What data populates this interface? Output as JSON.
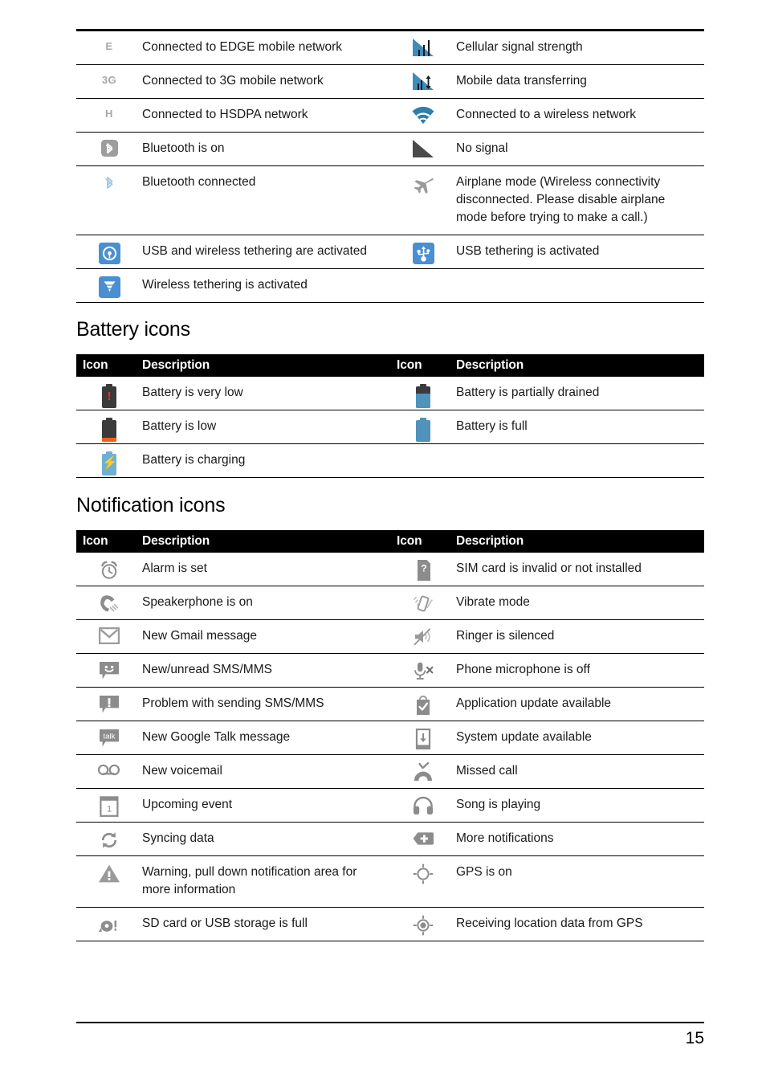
{
  "document": {
    "page_number": "15",
    "sections": [
      {
        "id": "status-icons-continued",
        "heading": null,
        "has_header_row": false,
        "rows": [
          {
            "left": {
              "icon": "edge-network-icon",
              "text": "Connected to EDGE mobile network"
            },
            "right": {
              "icon": "cellular-signal-icon",
              "text": "Cellular signal strength"
            }
          },
          {
            "left": {
              "icon": "3g-network-icon",
              "text": "Connected to 3G mobile network"
            },
            "right": {
              "icon": "mobile-data-transfer-icon",
              "text": "Mobile data transferring"
            }
          },
          {
            "left": {
              "icon": "hsdpa-network-icon",
              "text": "Connected to HSDPA network"
            },
            "right": {
              "icon": "wifi-connected-icon",
              "text": "Connected to a wireless network"
            }
          },
          {
            "left": {
              "icon": "bluetooth-on-icon",
              "text": "Bluetooth is on"
            },
            "right": {
              "icon": "no-signal-icon",
              "text": "No signal"
            }
          },
          {
            "left": {
              "icon": "bluetooth-connected-icon",
              "text": "Bluetooth connected"
            },
            "right": {
              "icon": "airplane-mode-icon",
              "text": "Airplane mode (Wireless connectivity disconnected. Please disable airplane mode before trying to make a call.)"
            }
          },
          {
            "left": {
              "icon": "usb-wireless-tethering-icon",
              "text": "USB and wireless tethering are activated"
            },
            "right": {
              "icon": "usb-tethering-icon",
              "text": "USB tethering is activated"
            }
          },
          {
            "left": {
              "icon": "wireless-tethering-icon",
              "text": "Wireless tethering is activated"
            },
            "right": {
              "icon": null,
              "text": ""
            }
          }
        ]
      },
      {
        "id": "battery-icons",
        "heading": "Battery icons",
        "has_header_row": true,
        "header": {
          "icon_label": "Icon",
          "description_label": "Description",
          "icon_label_2": "Icon",
          "description_label_2": "Description"
        },
        "rows": [
          {
            "left": {
              "icon": "battery-very-low-icon",
              "text": "Battery is very low"
            },
            "right": {
              "icon": "battery-partial-icon",
              "text": "Battery is partially drained"
            }
          },
          {
            "left": {
              "icon": "battery-low-icon",
              "text": "Battery is low"
            },
            "right": {
              "icon": "battery-full-icon",
              "text": "Battery is full"
            }
          },
          {
            "left": {
              "icon": "battery-charging-icon",
              "text": "Battery is charging"
            },
            "right": {
              "icon": null,
              "text": ""
            }
          }
        ]
      },
      {
        "id": "notification-icons",
        "heading": "Notification icons",
        "has_header_row": true,
        "header": {
          "icon_label": "Icon",
          "description_label": "Description",
          "icon_label_2": "Icon",
          "description_label_2": "Description"
        },
        "rows": [
          {
            "left": {
              "icon": "alarm-clock-icon",
              "text": "Alarm is set"
            },
            "right": {
              "icon": "sim-card-invalid-icon",
              "text": "SIM card is invalid or not installed"
            }
          },
          {
            "left": {
              "icon": "speakerphone-icon",
              "text": "Speakerphone is on"
            },
            "right": {
              "icon": "vibrate-mode-icon",
              "text": "Vibrate mode"
            }
          },
          {
            "left": {
              "icon": "gmail-icon",
              "text": "New Gmail message"
            },
            "right": {
              "icon": "ringer-silenced-icon",
              "text": "Ringer is silenced"
            }
          },
          {
            "left": {
              "icon": "sms-mms-icon",
              "text": "New/unread SMS/MMS"
            },
            "right": {
              "icon": "microphone-off-icon",
              "text": "Phone microphone is off"
            }
          },
          {
            "left": {
              "icon": "sms-problem-icon",
              "text": "Problem with sending SMS/MMS"
            },
            "right": {
              "icon": "app-update-icon",
              "text": "Application update available"
            }
          },
          {
            "left": {
              "icon": "google-talk-icon",
              "text": "New Google Talk message"
            },
            "right": {
              "icon": "system-update-icon",
              "text": "System update available"
            }
          },
          {
            "left": {
              "icon": "voicemail-icon",
              "text": "New voicemail"
            },
            "right": {
              "icon": "missed-call-icon",
              "text": "Missed call"
            }
          },
          {
            "left": {
              "icon": "calendar-event-icon",
              "text": "Upcoming event"
            },
            "right": {
              "icon": "headphones-icon",
              "text": "Song is playing"
            }
          },
          {
            "left": {
              "icon": "sync-icon",
              "text": "Syncing data"
            },
            "right": {
              "icon": "more-notifications-icon",
              "text": "More notifications"
            }
          },
          {
            "left": {
              "icon": "warning-icon",
              "text": "Warning, pull down notification area for more information"
            },
            "right": {
              "icon": "gps-on-icon",
              "text": "GPS is on"
            }
          },
          {
            "left": {
              "icon": "storage-full-icon",
              "text": "SD card or USB storage is full"
            },
            "right": {
              "icon": "gps-receiving-icon",
              "text": "Receiving location data from GPS"
            }
          }
        ]
      }
    ],
    "icon_glyph_text": {
      "edge": "E",
      "three_g": "3G",
      "hsdpa": "H",
      "google_talk": "talk"
    },
    "colors": {
      "signal_blue": "#3f8cba",
      "wifi_blue": "#2f7fa8",
      "tether_blue": "#4a8fd0",
      "battery_blue": "#4f93bb",
      "battery_dark": "#3b3b3b",
      "battery_red": "#e8312a",
      "battery_orange": "#f4601a",
      "notification_grey": "#8c8c8c",
      "header_bg": "#000000",
      "header_fg": "#ffffff",
      "text": "#1a1a1a"
    }
  }
}
